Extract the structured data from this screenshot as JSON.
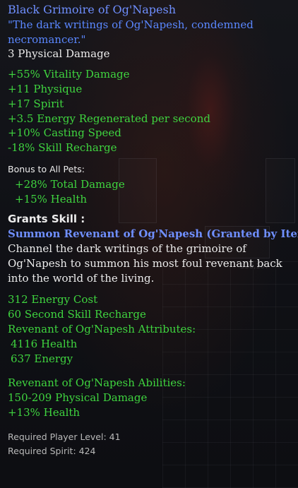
{
  "item": {
    "name": "Black Grimoire of Og'Napesh",
    "flavor_line1": "\"The dark writings of Og'Napesh, condemned",
    "flavor_line2": "necromancer.\"",
    "base_damage": "3 Physical Damage"
  },
  "stats": [
    "+55% Vitality Damage",
    "+11 Physique",
    "+17 Spirit",
    "+3.5 Energy Regenerated per second",
    "+10% Casting Speed",
    "-18% Skill Recharge"
  ],
  "pet_bonus": {
    "heading": "Bonus to All Pets:",
    "lines": [
      "+28% Total Damage",
      "+15% Health"
    ]
  },
  "skill": {
    "grants_label": "Grants Skill :",
    "name": "Summon Revenant of Og'Napesh (Granted by Item)",
    "description": [
      "Channel the dark writings of the grimoire of",
      "Og'Napesh to summon his most foul revenant back",
      "into the world of the living."
    ],
    "energy_cost": "312 Energy Cost",
    "recharge": "60 Second Skill Recharge",
    "attributes_heading": "Revenant of Og'Napesh Attributes:",
    "attributes": [
      "4116 Health",
      "637 Energy"
    ],
    "abilities_heading": "Revenant of Og'Napesh Abilities:",
    "abilities": [
      "150-209 Physical Damage",
      "+13% Health"
    ]
  },
  "requirements": {
    "level": "Required Player Level: 41",
    "spirit": "Required Spirit: 424"
  },
  "background": {
    "ghost_text": "330,107"
  },
  "colors": {
    "item_name": "#6f8fff",
    "stat_green": "#3fd43f",
    "text_white": "#ececec",
    "requirement_grey": "#b9b9b9"
  }
}
